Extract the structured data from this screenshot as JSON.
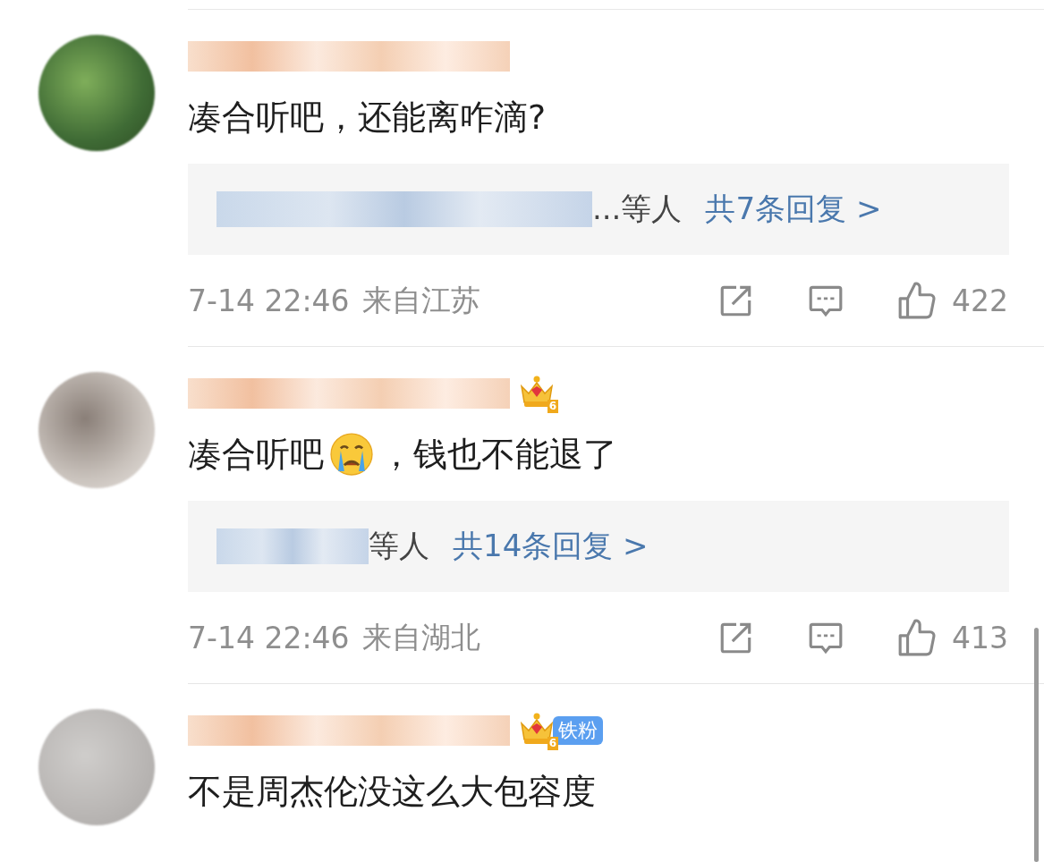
{
  "comments": [
    {
      "content": [
        {
          "kind": "text",
          "text": "凑合听吧，还能离咋滴?"
        }
      ],
      "replies": {
        "names_suffix": "...等人",
        "total": "共7条回复 >"
      },
      "time": "7-14 22:46",
      "location": "来自江苏",
      "likes": "422"
    },
    {
      "user": {
        "badge_level": "6"
      },
      "content": [
        {
          "kind": "text",
          "text": "凑合听吧"
        },
        {
          "kind": "emoji"
        },
        {
          "kind": "text",
          "text": "，钱也不能退了"
        }
      ],
      "replies": {
        "names_suffix": "等人",
        "total": "共14条回复 >"
      },
      "time": "7-14 22:46",
      "location": "来自湖北",
      "likes": "413"
    },
    {
      "user": {
        "badge_level": "6",
        "fan_tag": "铁粉"
      },
      "content": [
        {
          "kind": "text",
          "text": "不是周杰伦没这么大包容度"
        }
      ]
    }
  ]
}
